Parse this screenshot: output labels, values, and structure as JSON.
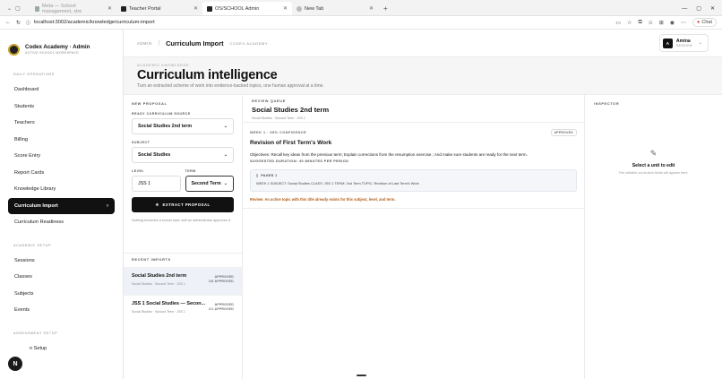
{
  "browser": {
    "tabs": [
      {
        "label": "Meta — School management, stre",
        "active": false
      },
      {
        "label": "Teacher Portal",
        "active": false
      },
      {
        "label": "OS/SCHOOL Admin",
        "active": true
      },
      {
        "label": "New Tab",
        "active": false
      }
    ],
    "url": "localhost:3002/academic/knowledge/curriculum-import",
    "chat_label": "Chat"
  },
  "brand": {
    "title": "Codex Academy · Admin",
    "subtitle": "ACTIVE SCHOOL WORKSPACE"
  },
  "sidebar": {
    "sections": [
      {
        "label": "DAILY OPERATIONS",
        "items": [
          "Dashboard",
          "Students",
          "Teachers",
          "Billing",
          "Score Entry",
          "Report Cards",
          "Knowledge Library",
          "Curriculum Import",
          "Curriculum Readiness"
        ]
      },
      {
        "label": "ACADEMIC SETUP",
        "items": [
          "Sessions",
          "Classes",
          "Subjects",
          "Events"
        ]
      },
      {
        "label": "ASSESSMENT SETUP",
        "items": [
          "Grade Setup"
        ]
      }
    ],
    "fab_label": "N",
    "partial_item": "n Setup"
  },
  "topbar": {
    "crumb": "ADMIN",
    "title": "Curriculum Import",
    "school": "CODEX ACADEMY",
    "user_initial": "A",
    "user_name": "Amina",
    "user_role": "SESSION"
  },
  "hero": {
    "kicker": "ACADEMIC KNOWLEDGE",
    "title": "Curriculum intelligence",
    "desc": "Turn an extracted scheme of work into evidence-backed topics, one human approval at a time."
  },
  "proposal": {
    "label": "NEW PROPOSAL",
    "source_label": "READY CURRICULUM SOURCE",
    "source_value": "Social Studies 2nd term",
    "subject_label": "SUBJECT",
    "subject_value": "Social Studies",
    "level_label": "LEVEL",
    "level_value": "JSS 1",
    "term_label": "TERM",
    "term_value": "Second Term",
    "button": "EXTRACT PROPOSAL",
    "hint": "Nothing becomes a school topic until an administrator approves it."
  },
  "recent": {
    "label": "RECENT IMPORTS",
    "items": [
      {
        "title": "Social Studies 2nd term",
        "sub": "Social Studies · Second Term · JSS 1",
        "status1": "APPROVED",
        "status2": "1/8 APPROVED",
        "active": true
      },
      {
        "title": "JSS 1 Social Studies — Secon...",
        "sub": "Social Studies · Second Term · JSS 1",
        "status1": "APPROVED",
        "status2": "1/1 APPROVED",
        "active": false
      }
    ]
  },
  "queue": {
    "label": "REVIEW QUEUE",
    "title": "Social Studies 2nd term",
    "sub": "Social Studies · Second Term · JSS 1",
    "unit": {
      "kicker": "WEEK 1 · 95% CONFIDENCE",
      "badge": "APPROVED",
      "title": "Revision of First Term's Work",
      "objectives": "Objectives: Recall key ideas from the previous term; Explain corrections from the resumption exercise.; And make sure students are ready for the next term.",
      "duration": "SUGGESTED DURATION: 40 MINUTES PER PERIOD",
      "evidence_tag": "PAGES 1",
      "evidence_text": "WEEK 1 SUBJECT: Social Studies CLASS: JSS 1 TERM: 2nd Term TOPIC: Revision of Last Term's Work",
      "review": "Review: An active topic with this title already exists for this subject, level, and term."
    }
  },
  "inspector": {
    "label": "INSPECTOR",
    "title": "Select a unit to edit",
    "desc": "The editable curriculum fields will appear here."
  }
}
